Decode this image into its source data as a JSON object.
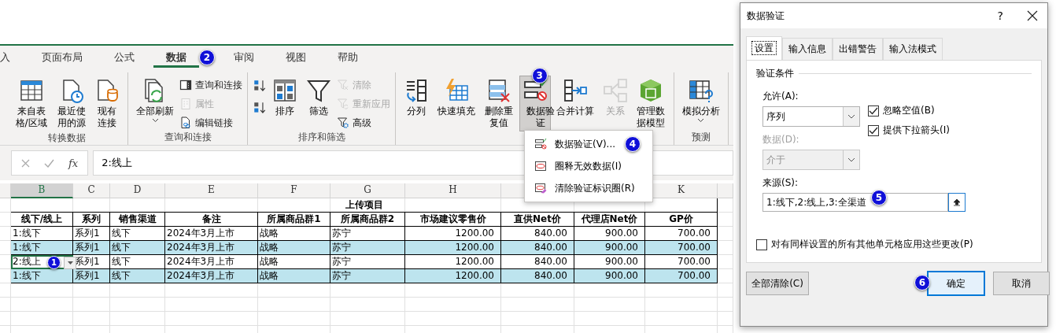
{
  "ribbon_tabs": [
    {
      "label": "入",
      "selected": false
    },
    {
      "label": "页面布局",
      "selected": false
    },
    {
      "label": "公式",
      "selected": false
    },
    {
      "label": "数据",
      "selected": true,
      "badge": "2"
    },
    {
      "label": "审阅",
      "selected": false
    },
    {
      "label": "视图",
      "selected": false
    },
    {
      "label": "帮助",
      "selected": false
    }
  ],
  "ribbon_groups": [
    {
      "label": "转换数据",
      "items": [
        {
          "kind": "large",
          "label": "来自表格/区域",
          "disabled": false,
          "pressed": false,
          "dropdown": false
        },
        {
          "kind": "large",
          "label": "最近使用的源",
          "disabled": false,
          "pressed": false,
          "dropdown": false
        },
        {
          "kind": "large",
          "label": "现有连接",
          "disabled": false,
          "pressed": false,
          "dropdown": false
        }
      ]
    },
    {
      "label": "查询和连接",
      "items": [
        {
          "kind": "large",
          "label": "全部刷新",
          "disabled": false,
          "pressed": false,
          "dropdown": true
        },
        {
          "kind": "small",
          "label": "查询和连接",
          "disabled": false,
          "pressed": false,
          "dropdown": false
        },
        {
          "kind": "small",
          "label": "属性",
          "disabled": true,
          "pressed": false,
          "dropdown": false
        },
        {
          "kind": "small",
          "label": "编辑链接",
          "disabled": false,
          "pressed": false,
          "dropdown": false
        }
      ]
    },
    {
      "label": "排序和筛选",
      "items": [
        {
          "kind": "icon",
          "disabled": false,
          "pressed": false,
          "dropdown": false
        },
        {
          "kind": "icon",
          "disabled": false,
          "pressed": false,
          "dropdown": false
        },
        {
          "kind": "large",
          "label": "排序",
          "disabled": false,
          "pressed": false,
          "dropdown": false
        },
        {
          "kind": "large",
          "label": "筛选",
          "disabled": false,
          "pressed": false,
          "dropdown": false
        },
        {
          "kind": "small",
          "label": "清除",
          "disabled": true,
          "pressed": false,
          "dropdown": false
        },
        {
          "kind": "small",
          "label": "重新应用",
          "disabled": true,
          "pressed": false,
          "dropdown": false
        },
        {
          "kind": "small",
          "label": "高级",
          "disabled": false,
          "pressed": false,
          "dropdown": false
        }
      ]
    },
    {
      "items": [
        {
          "kind": "large",
          "label": "分列",
          "disabled": false,
          "pressed": false,
          "dropdown": false
        },
        {
          "kind": "large",
          "label": "快速填充",
          "disabled": false,
          "pressed": false,
          "dropdown": false
        },
        {
          "kind": "large",
          "label": "删除重复值",
          "disabled": false,
          "pressed": false,
          "dropdown": false
        },
        {
          "kind": "large",
          "label": "数据验证",
          "disabled": false,
          "pressed": true,
          "dropdown": true,
          "badge": "3"
        },
        {
          "kind": "large",
          "label": "合并计算",
          "disabled": false,
          "pressed": false,
          "dropdown": false
        },
        {
          "kind": "large",
          "label": "关系",
          "disabled": true,
          "pressed": false,
          "dropdown": false
        },
        {
          "kind": "large",
          "label": "管理数据模型",
          "disabled": false,
          "pressed": false,
          "dropdown": false
        }
      ]
    },
    {
      "label": "预测",
      "items": [
        {
          "kind": "large",
          "label": "模拟分析",
          "disabled": false,
          "pressed": false,
          "dropdown": true
        }
      ]
    }
  ],
  "validation_menu": {
    "items": [
      {
        "label": "数据验证(V)...",
        "badge": "4"
      },
      {
        "label": "圈释无效数据(I)"
      },
      {
        "label": "清除验证标识圈(R)"
      }
    ]
  },
  "formula_bar": {
    "function_label": "fx",
    "value": "2:线上"
  },
  "column_headers": [
    {
      "label": "B",
      "selected": true
    },
    {
      "label": "C",
      "selected": false
    },
    {
      "label": "D",
      "selected": false
    },
    {
      "label": "E",
      "selected": false
    },
    {
      "label": "F",
      "selected": false
    },
    {
      "label": "G",
      "selected": false
    },
    {
      "label": "H",
      "selected": false
    },
    {
      "label": "K",
      "selected": false
    }
  ],
  "table": {
    "title": "上传项目",
    "headers": [
      "线下/线上",
      "系列",
      "销售渠道",
      "备注",
      "所属商品群1",
      "所属商品群2",
      "市场建议零售价",
      "直供Net价",
      "代理店Net价",
      "GP价"
    ],
    "rows": [
      {
        "highlighted": false,
        "active": false,
        "cells": [
          "1:线下",
          "系列1",
          "线下",
          "2024年3月上市",
          "战略",
          "苏宁",
          "1200.00",
          "840.00",
          "900.00",
          "700.00"
        ]
      },
      {
        "highlighted": true,
        "active": false,
        "cells": [
          "1:线下",
          "系列1",
          "线下",
          "2024年3月上市",
          "战略",
          "苏宁",
          "1200.00",
          "840.00",
          "900.00",
          "700.00"
        ]
      },
      {
        "highlighted": false,
        "active": true,
        "badge": "1",
        "cells": [
          "2:线上",
          "系列1",
          "线下",
          "2024年3月上市",
          "战略",
          "苏宁",
          "1200.00",
          "840.00",
          "900.00",
          "700.00"
        ]
      },
      {
        "highlighted": true,
        "active": false,
        "cells": [
          "1:线下",
          "系列1",
          "线下",
          "2024年3月上市",
          "战略",
          "苏宁",
          "1200.00",
          "840.00",
          "900.00",
          "700.00"
        ]
      }
    ]
  },
  "dialog": {
    "title": "数据验证",
    "help": "?",
    "tabs": [
      {
        "label": "设置",
        "selected": true
      },
      {
        "label": "输入信息",
        "selected": false
      },
      {
        "label": "出错警告",
        "selected": false
      },
      {
        "label": "输入法模式",
        "selected": false
      }
    ],
    "section": "验证条件",
    "allow": {
      "label": "允许(A):",
      "value": "序列",
      "disabled": false
    },
    "checkboxes": [
      {
        "label": "忽略空值(B)",
        "checked": true
      },
      {
        "label": "提供下拉箭头(I)",
        "checked": true
      }
    ],
    "data": {
      "label": "数据(D):",
      "value": "介于",
      "disabled": true
    },
    "source": {
      "label": "来源(S):",
      "value": "1:线下,2:线上,3:全渠道",
      "badge": "5"
    },
    "apply_all": {
      "label": "对有同样设置的所有其他单元格应用这些更改(P)",
      "checked": false
    },
    "buttons": [
      {
        "label": "全部清除(C)",
        "default": false
      },
      {
        "label": "确定",
        "default": true,
        "badge": "6"
      },
      {
        "label": "取消",
        "default": false
      }
    ]
  }
}
